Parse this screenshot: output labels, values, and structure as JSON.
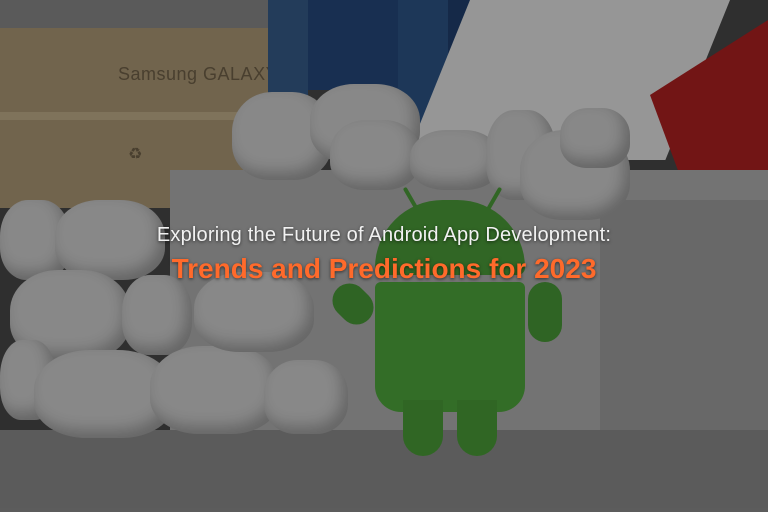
{
  "banner": {
    "subtitle": "Exploring the Future of Android App Development:",
    "title": "Trends and Predictions for 2023",
    "title_color": "#ff6a2b",
    "subtitle_color": "#f2f2f2"
  },
  "background": {
    "box_label": "Samsung GALAXY",
    "box_icon": "recycle-icon",
    "mascot": "android-robot",
    "props": "marshmallows"
  }
}
